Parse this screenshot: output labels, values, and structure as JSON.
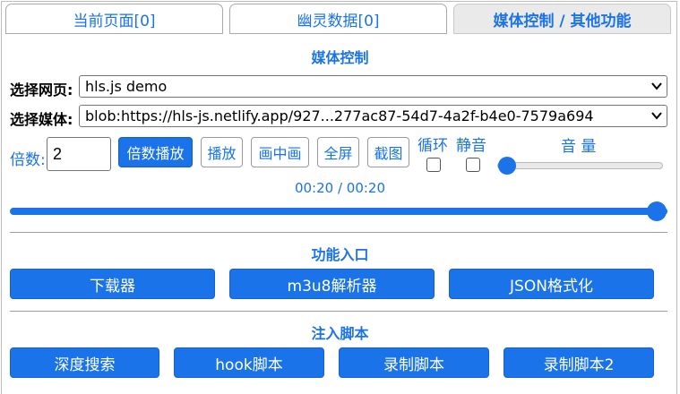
{
  "tabs": [
    {
      "label": "当前页面[0]",
      "active": false
    },
    {
      "label": "幽灵数据[0]",
      "active": false
    },
    {
      "label": "媒体控制 / 其他功能",
      "active": true
    }
  ],
  "media": {
    "section_title": "媒体控制",
    "page_label": "选择网页:",
    "page_value": "hls.js demo",
    "media_label": "选择媒体:",
    "media_value": "blob:https://hls-js.netlify.app/927...277ac87-54d7-4a2f-b4e0-7579a694",
    "rate_label": "倍数:",
    "rate_value": "2",
    "rate_button": "倍数播放",
    "play_button": "播放",
    "pip_button": "画中画",
    "fullscreen_button": "全屏",
    "screenshot_button": "截图",
    "loop_label": "循环",
    "mute_label": "静音",
    "volume_label": "音 量",
    "loop_checked": false,
    "mute_checked": false,
    "volume_level": 0.0,
    "time_text": "00:20 / 00:20",
    "progress_fraction": 1.0
  },
  "features": {
    "section_title": "功能入口",
    "buttons": [
      "下载器",
      "m3u8解析器",
      "JSON格式化"
    ]
  },
  "scripts": {
    "section_title": "注入脚本",
    "buttons": [
      "深度搜索",
      "hook脚本",
      "录制脚本",
      "录制脚本2"
    ]
  },
  "colors": {
    "accent": "#1a73e8"
  }
}
